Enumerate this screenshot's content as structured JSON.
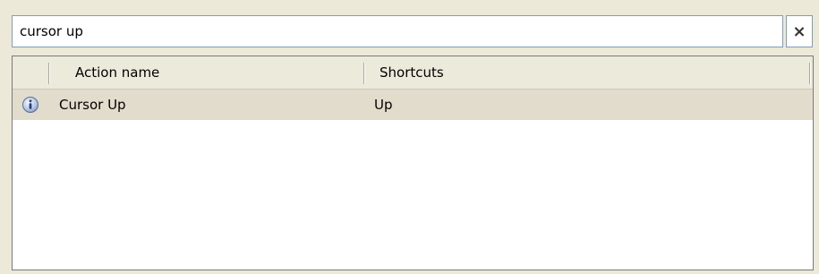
{
  "search": {
    "value": "cursor up",
    "clear_label": "×"
  },
  "table": {
    "columns": [
      {
        "label": ""
      },
      {
        "label": "Action name"
      },
      {
        "label": "Shortcuts"
      }
    ],
    "rows": [
      {
        "icon": "info-icon",
        "action": "Cursor Up",
        "shortcut": "Up"
      }
    ]
  }
}
